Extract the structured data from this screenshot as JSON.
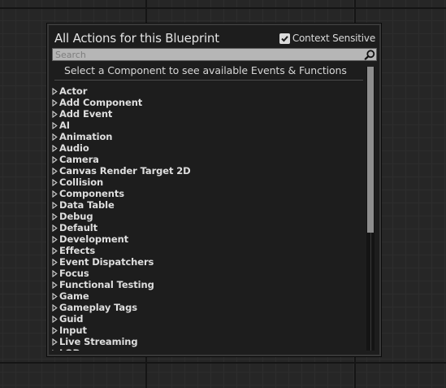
{
  "panel": {
    "title": "All Actions for this Blueprint",
    "context_sensitive": {
      "label": "Context Sensitive",
      "checked": true
    },
    "search": {
      "placeholder": "Search",
      "value": ""
    },
    "hint": "Select a Component to see available Events & Functions",
    "categories": [
      "Actor",
      "Add Component",
      "Add Event",
      "AI",
      "Animation",
      "Audio",
      "Camera",
      "Canvas Render Target 2D",
      "Collision",
      "Components",
      "Data Table",
      "Debug",
      "Default",
      "Development",
      "Effects",
      "Event Dispatchers",
      "Focus",
      "Functional Testing",
      "Game",
      "Gameplay Tags",
      "Guid",
      "Input",
      "Live Streaming",
      "LOD"
    ]
  },
  "colors": {
    "background": "#262626",
    "panel": "#1d1d1d",
    "search_bg": "#b6b6b6",
    "scroll_thumb": "#8e8e8e"
  },
  "icons": {
    "checkbox": "check-icon",
    "search": "magnifier-icon",
    "category": "triangle-right-icon"
  }
}
